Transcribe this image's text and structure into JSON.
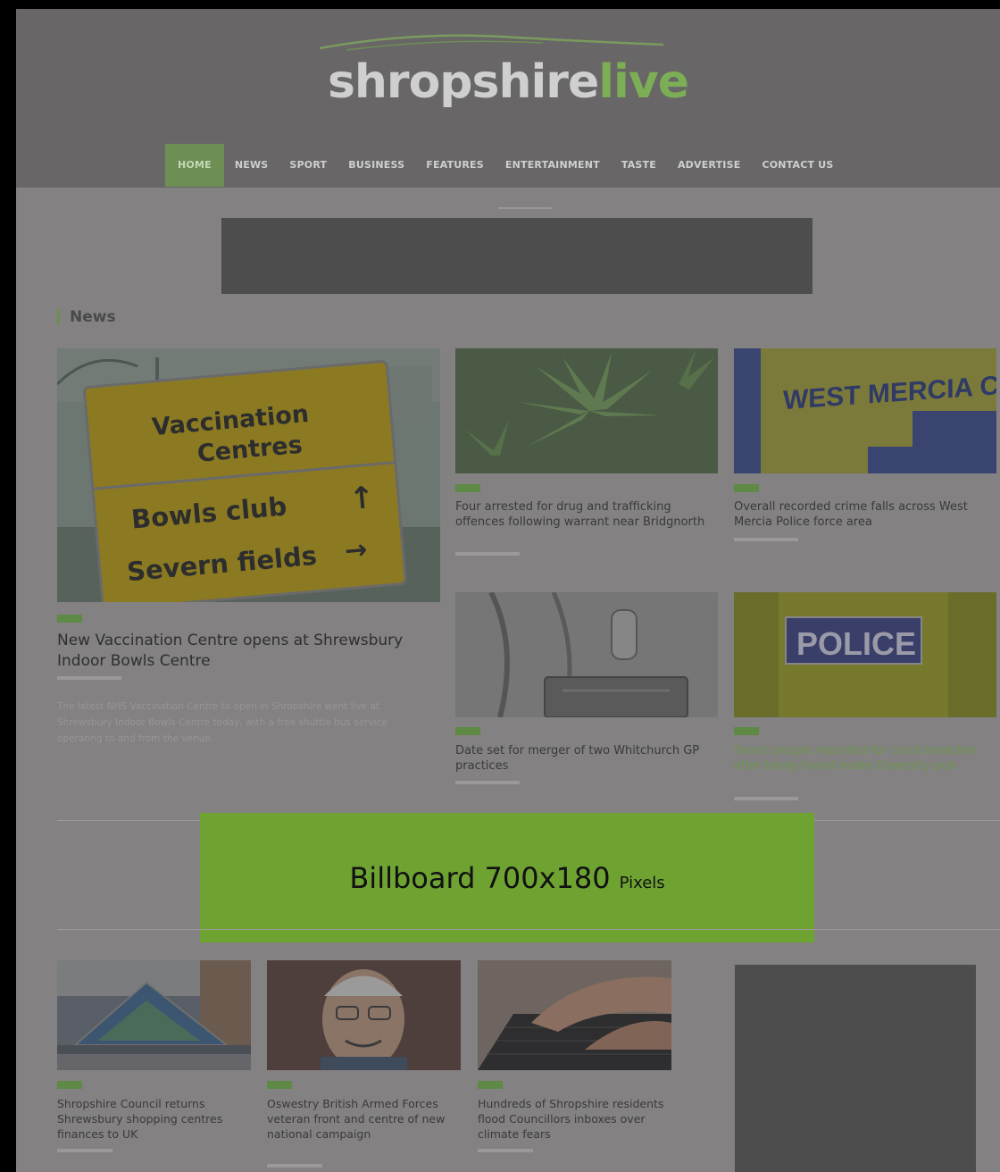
{
  "header": {
    "logo_part1": "shropshire",
    "logo_part2": "live",
    "nav": [
      "HOME",
      "NEWS",
      "SPORT",
      "BUSINESS",
      "FEATURES",
      "ENTERTAINMENT",
      "TASTE",
      "ADVERTISE",
      "CONTACT US"
    ],
    "active_nav": "HOME"
  },
  "section": {
    "title": "News"
  },
  "featured": {
    "sign_line1": "Vaccination",
    "sign_line2": "Centres",
    "sign_line3": "Bowls club",
    "sign_line4": "Severn fields",
    "headline": "New Vaccination Centre opens at Shrewsbury Indoor Bowls Centre",
    "excerpt": "The latest NHS Vaccination Centre to open in Shropshire went live at Shrewsbury Indoor Bowls Centre today, with a free shuttle bus service operating to and from the venue."
  },
  "grid": [
    {
      "headline": "Four arrested for drug and trafficking offences following warrant near Bridgnorth"
    },
    {
      "headline": "Overall recorded crime falls across West Mercia Police force area",
      "image_text": "WEST MERCIA CONSTABULARY"
    },
    {
      "headline": "Date set for merger of two Whitchurch GP practices"
    },
    {
      "headline": "Seven people reported for covid breaches after being found inside Oswestry pub",
      "image_text": "POLICE"
    }
  ],
  "billboard": {
    "label": "Billboard 700x180",
    "unit": "Pixels"
  },
  "bottom": [
    {
      "headline": "Shropshire Council returns Shrewsbury shopping centres finances to UK"
    },
    {
      "headline": "Oswestry British Armed Forces veteran front and centre of new national campaign"
    },
    {
      "headline": "Hundreds of Shropshire residents flood Councillors inboxes over climate fears"
    }
  ],
  "colors": {
    "brand_green": "#7cae55",
    "billboard_green": "#6ea332"
  }
}
